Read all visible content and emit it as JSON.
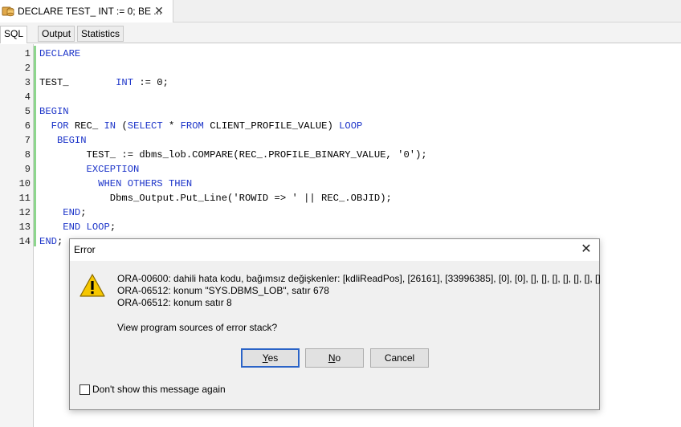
{
  "window": {
    "tab_title": "DECLARE TEST_ INT := 0; BE ...",
    "close_glyph": "✕"
  },
  "subtabs": [
    "SQL",
    "Output",
    "Statistics"
  ],
  "editor": {
    "line_numbers": [
      "1",
      "2",
      "3",
      "4",
      "5",
      "6",
      "7",
      "8",
      "9",
      "10",
      "11",
      "12",
      "13",
      "14"
    ]
  },
  "dialog": {
    "title": "Error",
    "close_glyph": "✕",
    "icon": "warning-icon",
    "message_lines": [
      "ORA-00600: dahili hata kodu, bağımsız değişkenler: [kdliReadPos], [26161], [33996385], [0], [0], [], [], [], [], [], [], []",
      "ORA-06512: konum \"SYS.DBMS_LOB\",  satır 678",
      "ORA-06512: konum  satır 8"
    ],
    "question": "View program sources of error stack?",
    "buttons": {
      "yes": "Yes",
      "no": "No",
      "cancel": "Cancel"
    },
    "checkbox_label": "Don't show this message again",
    "checkbox_checked": false
  },
  "colors": {
    "keyword": "#1d35c9",
    "gutter_change_bar": "#8dd68d",
    "default_button_border": "#2a63c7"
  }
}
